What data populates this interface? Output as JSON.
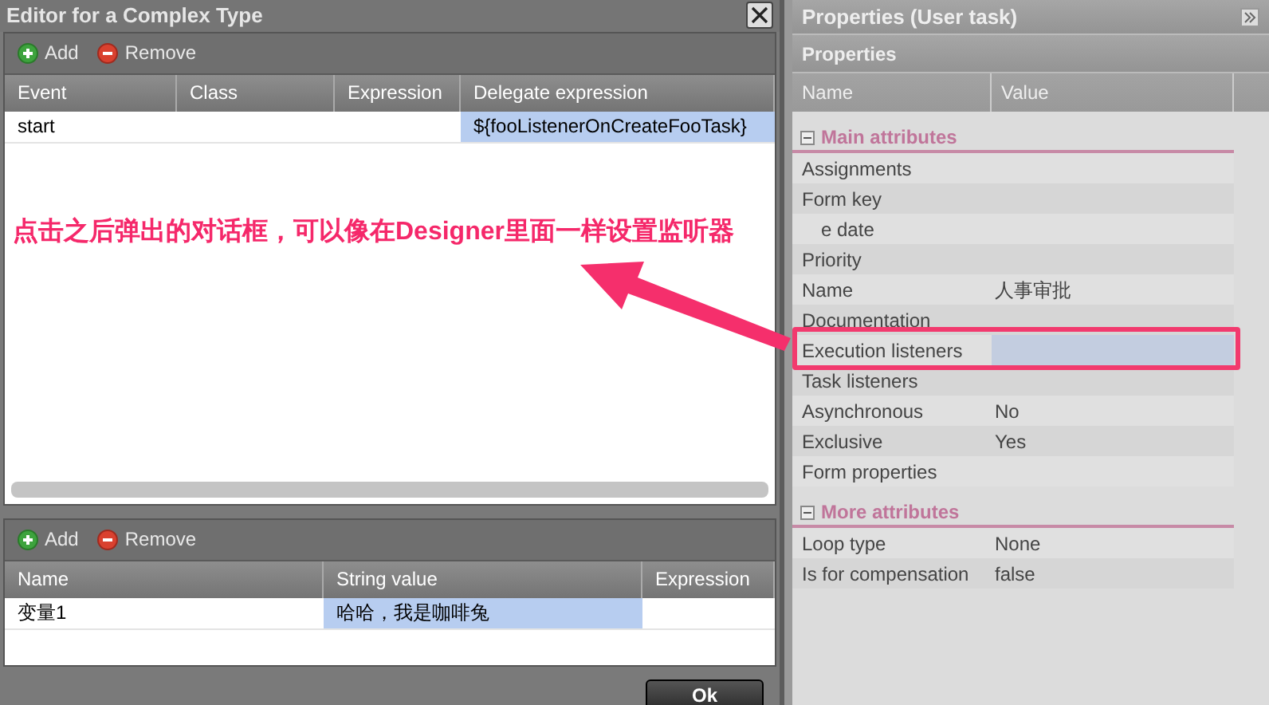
{
  "dialog": {
    "title": "Editor for a Complex Type",
    "ok_button": "Ok",
    "listeners": {
      "toolbar": {
        "add": "Add",
        "remove": "Remove"
      },
      "columns": [
        "Event",
        "Class",
        "Expression",
        "Delegate expression"
      ],
      "rows": [
        {
          "cells": [
            {
              "text": "start",
              "selected": false
            },
            {
              "text": "",
              "selected": false
            },
            {
              "text": "",
              "selected": false
            },
            {
              "text": "${fooListenerOnCreateFooTask}",
              "selected": true
            }
          ]
        }
      ]
    },
    "fields": {
      "toolbar": {
        "add": "Add",
        "remove": "Remove"
      },
      "columns": [
        "Name",
        "String value",
        "Expression"
      ],
      "rows": [
        {
          "cells": [
            {
              "text": "变量1",
              "selected": false
            },
            {
              "text": "哈哈，我是咖啡兔",
              "selected": true
            },
            {
              "text": "",
              "selected": false
            }
          ]
        }
      ]
    }
  },
  "properties": {
    "title": "Properties (User task)",
    "subtitle": "Properties",
    "columns": [
      "Name",
      "Value"
    ],
    "sections": [
      {
        "title": "Main attributes",
        "expanded": true,
        "rows": [
          {
            "name": "Assignments",
            "value": "",
            "kind": "plain"
          },
          {
            "name": "Form key",
            "value": "",
            "kind": "plain"
          },
          {
            "name": "e date",
            "value": "",
            "kind": "covered"
          },
          {
            "name": "Priority",
            "value": "",
            "kind": "plain"
          },
          {
            "name": "Name",
            "value": "人事审批",
            "kind": "plain"
          },
          {
            "name": "Documentation",
            "value": "",
            "kind": "plain"
          },
          {
            "name": "Execution listeners",
            "value": "",
            "kind": "highlighted"
          },
          {
            "name": "Task listeners",
            "value": "",
            "kind": "plain"
          },
          {
            "name": "Asynchronous",
            "value": "No",
            "kind": "plain"
          },
          {
            "name": "Exclusive",
            "value": "Yes",
            "kind": "plain"
          },
          {
            "name": "Form properties",
            "value": "",
            "kind": "plain"
          }
        ]
      },
      {
        "title": "More attributes",
        "expanded": true,
        "rows": [
          {
            "name": "Loop type",
            "value": "None",
            "kind": "plain"
          },
          {
            "name": "Is for compensation",
            "value": "false",
            "kind": "plain"
          }
        ]
      }
    ]
  },
  "annotation": {
    "text": "点击之后弹出的对话框，可以像在**Designer**里面一样设置监听器"
  }
}
